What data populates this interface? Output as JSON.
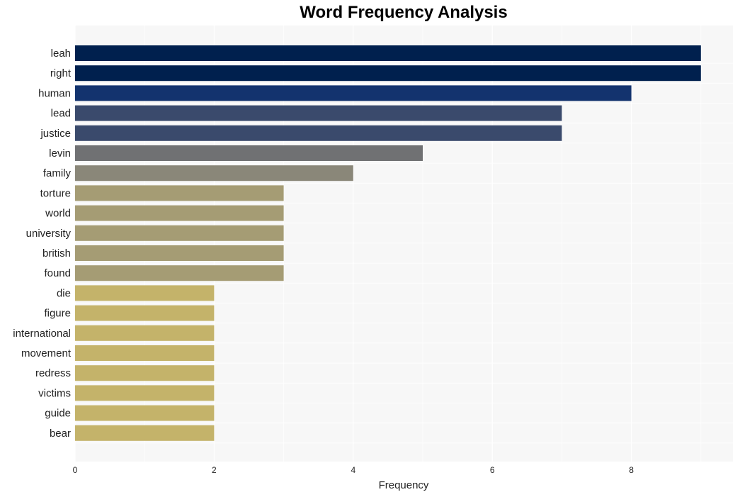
{
  "chart_data": {
    "type": "bar",
    "orientation": "horizontal",
    "title": "Word Frequency Analysis",
    "xlabel": "Frequency",
    "ylabel": "",
    "xlim": [
      0,
      9.45
    ],
    "xticks": [
      0,
      2,
      4,
      6,
      8
    ],
    "grid": true,
    "categories": [
      "leah",
      "right",
      "human",
      "lead",
      "justice",
      "levin",
      "family",
      "torture",
      "world",
      "university",
      "british",
      "found",
      "die",
      "figure",
      "international",
      "movement",
      "redress",
      "victims",
      "guide",
      "bear"
    ],
    "values": [
      9,
      9,
      8,
      7,
      7,
      5,
      4,
      3,
      3,
      3,
      3,
      3,
      2,
      2,
      2,
      2,
      2,
      2,
      2,
      2
    ],
    "colors": [
      "#00204e",
      "#00204e",
      "#13336e",
      "#3a4a6c",
      "#3a4a6c",
      "#707173",
      "#8a8779",
      "#a59c74",
      "#a59c74",
      "#a59c74",
      "#a59c74",
      "#a59c74",
      "#c4b36a",
      "#c4b36a",
      "#c4b36a",
      "#c4b36a",
      "#c4b36a",
      "#c4b36a",
      "#c4b36a",
      "#c4b36a"
    ]
  }
}
